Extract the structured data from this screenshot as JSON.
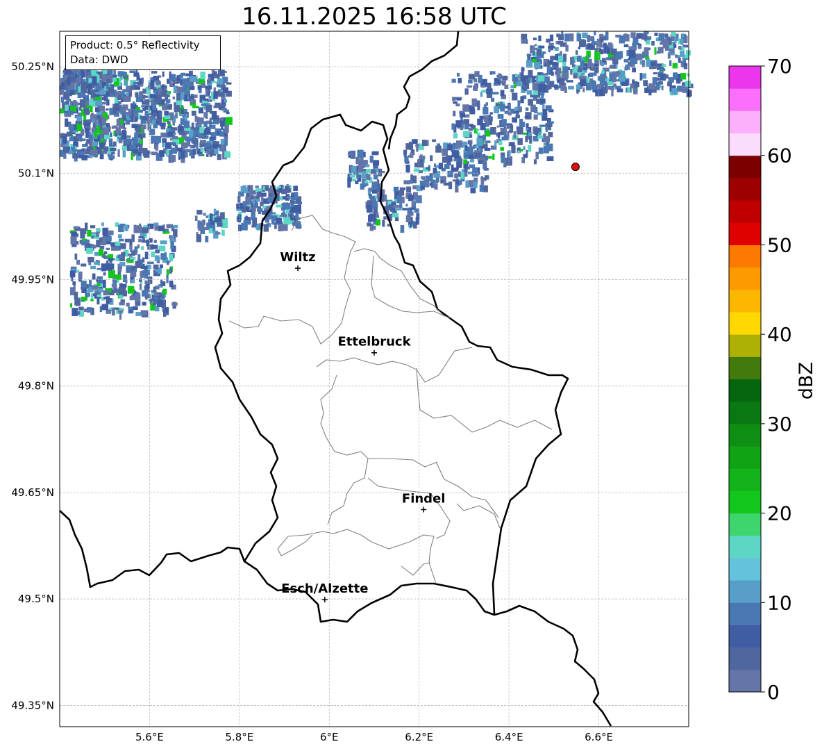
{
  "title": "16.11.2025 16:58 UTC",
  "info_box": {
    "line1": "Product: 0.5° Reflectivity",
    "line2": "Data: DWD"
  },
  "map": {
    "lon_range": [
      5.4,
      6.8
    ],
    "lat_range": [
      49.32,
      50.3
    ],
    "lon_ticks": [
      "5.6°E",
      "5.8°E",
      "6°E",
      "6.2°E",
      "6.4°E",
      "6.6°E"
    ],
    "lat_ticks": [
      "50.25°N",
      "50.1°N",
      "49.95°N",
      "49.8°N",
      "49.65°N",
      "49.5°N",
      "49.35°N"
    ],
    "grid": true,
    "cities": [
      {
        "name": "Wiltz",
        "lon": 5.93,
        "lat": 49.966
      },
      {
        "name": "Ettelbruck",
        "lon": 6.1,
        "lat": 49.847
      },
      {
        "name": "Findel",
        "lon": 6.21,
        "lat": 49.626
      },
      {
        "name": "Esch/Alzette",
        "lon": 5.99,
        "lat": 49.499
      }
    ],
    "radar_site": {
      "lon": 6.548,
      "lat": 50.109,
      "color": "#e01010"
    }
  },
  "colorbar": {
    "label": "dBZ",
    "ticks": [
      "0",
      "10",
      "20",
      "30",
      "40",
      "50",
      "60",
      "70"
    ],
    "range": [
      0,
      70
    ],
    "step": 2.5,
    "colors": [
      "#6475a8",
      "#50669e",
      "#405da4",
      "#4a78b2",
      "#579ec8",
      "#64c2dc",
      "#5ed6c6",
      "#3ed46e",
      "#12c61c",
      "#12b41a",
      "#10a414",
      "#0e8e12",
      "#0a7812",
      "#066610",
      "#427a0c",
      "#aeb004",
      "#fed800",
      "#fcb800",
      "#fc9a00",
      "#fc7a00",
      "#e00000",
      "#c00000",
      "#9e0000",
      "#7c0000",
      "#fcdcfc",
      "#fcb0fc",
      "#fc6efc",
      "#ec36ec"
    ]
  }
}
